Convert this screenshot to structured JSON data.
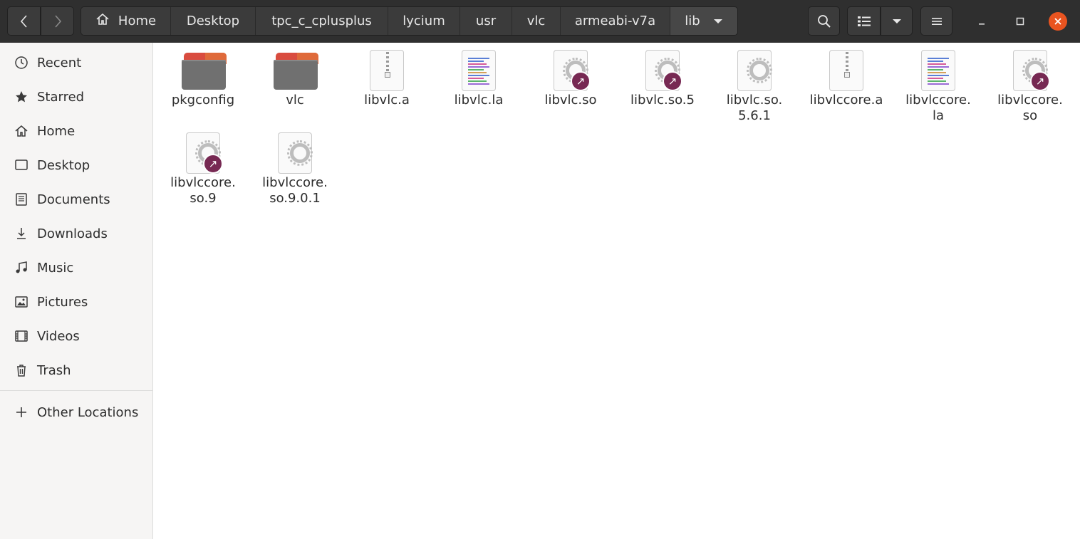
{
  "breadcrumbs": [
    {
      "label": "Home",
      "width": 126
    },
    {
      "label": "Desktop",
      "width": 119
    },
    {
      "label": "tpc_c_cplusplus",
      "width": 186
    },
    {
      "label": "lycium",
      "width": 101
    },
    {
      "label": "usr",
      "width": 73
    },
    {
      "label": "vlc",
      "width": 68
    },
    {
      "label": "armeabi-v7a",
      "width": 154
    },
    {
      "label": "lib",
      "width": 94
    }
  ],
  "sidebar": {
    "items": [
      {
        "label": "Recent",
        "icon": "clock-icon"
      },
      {
        "label": "Starred",
        "icon": "star-icon"
      },
      {
        "label": "Home",
        "icon": "home-icon"
      },
      {
        "label": "Desktop",
        "icon": "desktop-icon"
      },
      {
        "label": "Documents",
        "icon": "document-icon"
      },
      {
        "label": "Downloads",
        "icon": "download-icon"
      },
      {
        "label": "Music",
        "icon": "music-icon"
      },
      {
        "label": "Pictures",
        "icon": "picture-icon"
      },
      {
        "label": "Videos",
        "icon": "video-icon"
      },
      {
        "label": "Trash",
        "icon": "trash-icon"
      }
    ],
    "other_locations": "Other Locations"
  },
  "files": [
    {
      "name": "pkgconfig",
      "type": "folder"
    },
    {
      "name": "vlc",
      "type": "folder"
    },
    {
      "name": "libvlc.a",
      "type": "archive"
    },
    {
      "name": "libvlc.la",
      "type": "text"
    },
    {
      "name": "libvlc.so",
      "type": "library-link"
    },
    {
      "name": "libvlc.so.5",
      "type": "library-link"
    },
    {
      "name": "libvlc.so.\n5.6.1",
      "type": "library"
    },
    {
      "name": "libvlccore.a",
      "type": "archive"
    },
    {
      "name": "libvlccore.\nla",
      "type": "text"
    },
    {
      "name": "libvlccore.\nso",
      "type": "library-link"
    },
    {
      "name": "libvlccore.\nso.9",
      "type": "library-link"
    },
    {
      "name": "libvlccore.\nso.9.0.1",
      "type": "library"
    }
  ],
  "colors": {
    "accent_close": "#e95420",
    "link_badge": "#772953",
    "headerbar": "#2f2f2f",
    "sidebar_bg": "#f6f5f4"
  }
}
